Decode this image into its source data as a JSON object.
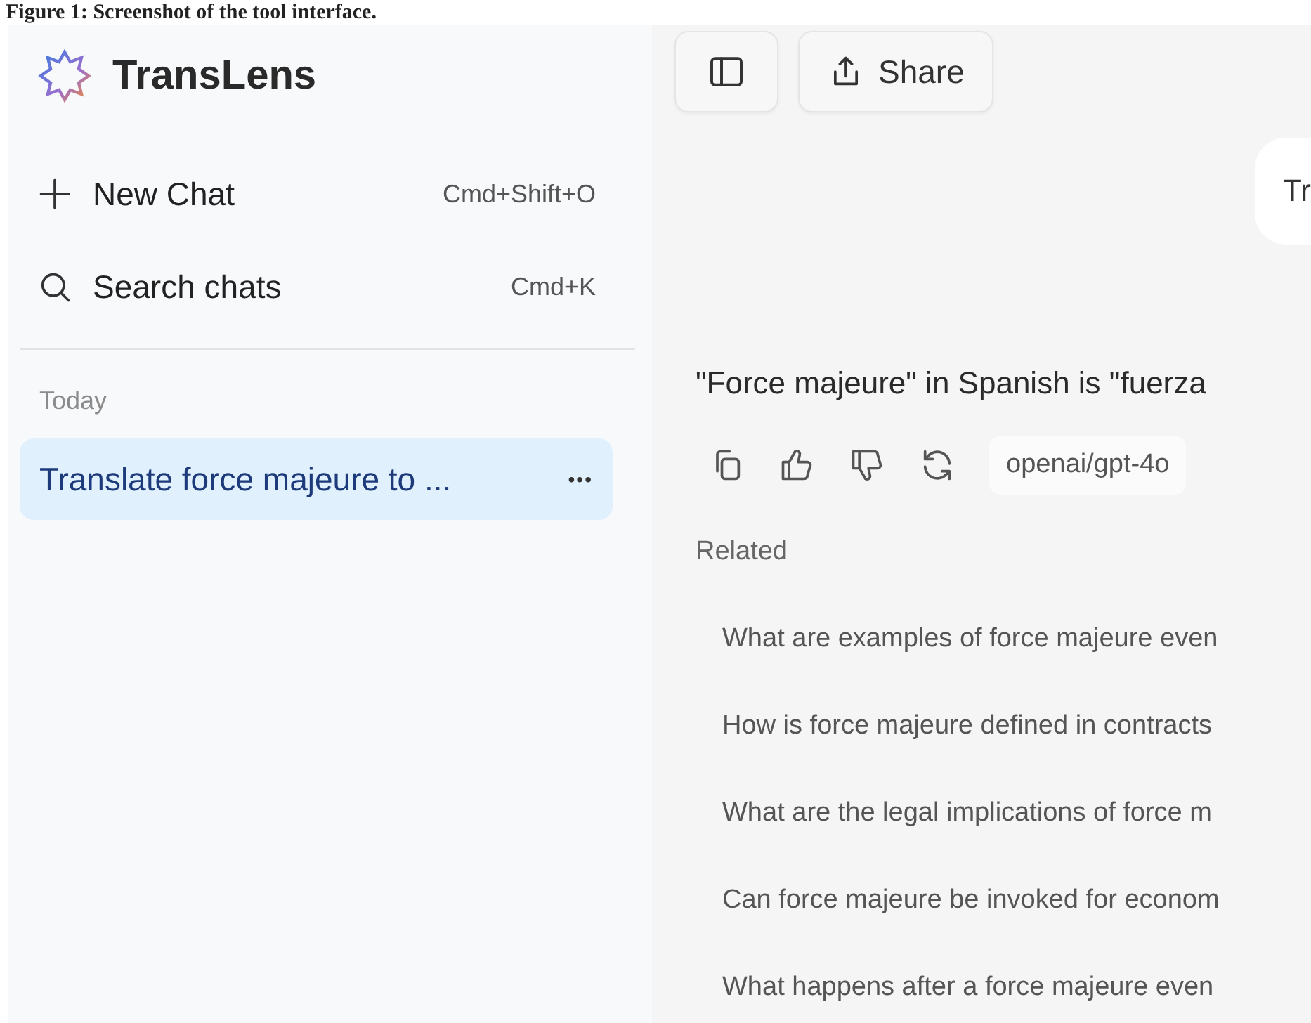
{
  "caption": "Figure 1: Screenshot of the tool interface.",
  "sidebar": {
    "app_name": "TransLens",
    "actions": [
      {
        "kind": "new",
        "label": "New Chat",
        "shortcut": "Cmd+Shift+O"
      },
      {
        "kind": "search",
        "label": "Search chats",
        "shortcut": "Cmd+K"
      }
    ],
    "section": "Today",
    "chats": [
      {
        "title": "Translate force majeure to ...",
        "selected": true,
        "more": "•••"
      }
    ]
  },
  "toolbar": {
    "share": "Share"
  },
  "conversation": {
    "user_message": "Tr",
    "reply": "\"Force majeure\" in Spanish is \"fuerza",
    "model": "openai/gpt-4o",
    "related_title": "Related",
    "related": [
      "What are examples of force majeure even",
      "How is force majeure defined in contracts",
      "What are the legal implications of force m",
      "Can force majeure be invoked for econom",
      "What happens after a force majeure even"
    ]
  }
}
